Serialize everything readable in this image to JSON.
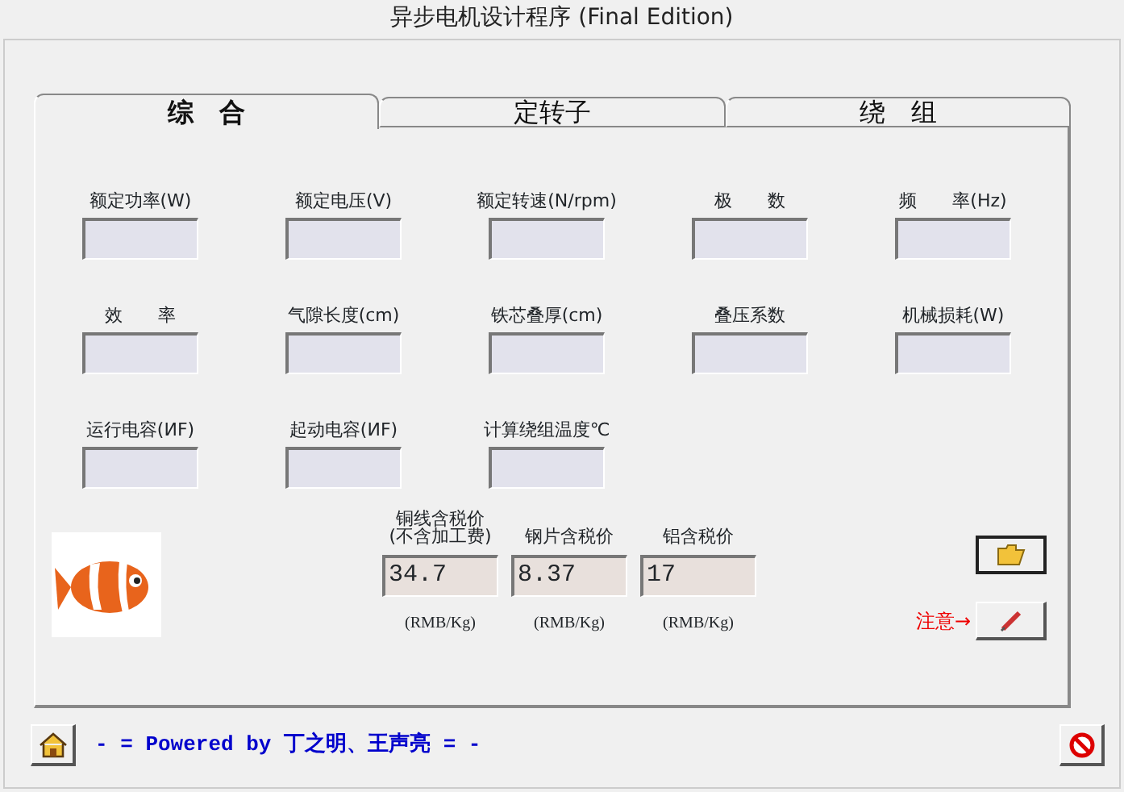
{
  "window": {
    "title": "异步电机设计程序 (Final Edition)"
  },
  "tabs": [
    {
      "label": "综　合",
      "selected": true
    },
    {
      "label": "定转子",
      "selected": false
    },
    {
      "label": "绕　组",
      "selected": false
    }
  ],
  "field_rows": [
    [
      {
        "label": "额定功率(W)"
      },
      {
        "label": "额定电压(V)"
      },
      {
        "label": "额定转速(N/rpm)"
      },
      {
        "label": "极　　数"
      },
      {
        "label": "频　　率(Hz)"
      }
    ],
    [
      {
        "label": "效　　率"
      },
      {
        "label": "气隙长度(cm)"
      },
      {
        "label": "铁芯叠厚(cm)"
      },
      {
        "label": "叠压系数"
      },
      {
        "label": "机械损耗(W)"
      }
    ],
    [
      {
        "label": "运行电容(ИF)"
      },
      {
        "label": "起动电容(ИF)"
      },
      {
        "label": "计算绕组温度℃"
      }
    ]
  ],
  "prices": [
    {
      "label": "铜线含税价",
      "label_line2": "(不含加工费)",
      "value": "34.7",
      "unit": "(RMB/Kg)"
    },
    {
      "label": "钢片含税价",
      "value": "8.37",
      "unit": "(RMB/Kg)"
    },
    {
      "label": "铝含税价",
      "value": "17",
      "unit": "(RMB/Kg)"
    }
  ],
  "note": "注意→",
  "footer": {
    "credit": "- = Powered by 丁之明、王声亮 = -"
  }
}
